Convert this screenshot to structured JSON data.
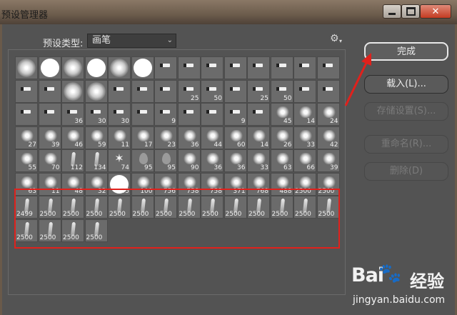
{
  "window": {
    "title": "预设管理器"
  },
  "preset_type": {
    "label": "预设类型:",
    "value": "画笔"
  },
  "buttons": {
    "done": "完成",
    "load": "载入(L)...",
    "save": "存储设置(S)...",
    "rename": "重命名(R)...",
    "delete": "删除(D)"
  },
  "brushes": [
    {
      "kind": "soft",
      "n": ""
    },
    {
      "kind": "hard",
      "n": ""
    },
    {
      "kind": "soft",
      "n": ""
    },
    {
      "kind": "hard",
      "n": ""
    },
    {
      "kind": "soft",
      "n": ""
    },
    {
      "kind": "hard",
      "n": ""
    },
    {
      "kind": "tip",
      "n": ""
    },
    {
      "kind": "tip",
      "n": ""
    },
    {
      "kind": "tip",
      "n": ""
    },
    {
      "kind": "tip",
      "n": ""
    },
    {
      "kind": "tip",
      "n": ""
    },
    {
      "kind": "tip",
      "n": ""
    },
    {
      "kind": "tip",
      "n": ""
    },
    {
      "kind": "tip",
      "n": ""
    },
    {
      "kind": "tip",
      "n": ""
    },
    {
      "kind": "tip",
      "n": ""
    },
    {
      "kind": "soft",
      "n": ""
    },
    {
      "kind": "soft",
      "n": ""
    },
    {
      "kind": "tip",
      "n": ""
    },
    {
      "kind": "tip",
      "n": ""
    },
    {
      "kind": "tip",
      "n": ""
    },
    {
      "kind": "tip",
      "n": "25"
    },
    {
      "kind": "tip",
      "n": "50"
    },
    {
      "kind": "tip",
      "n": ""
    },
    {
      "kind": "tip",
      "n": "25"
    },
    {
      "kind": "tip",
      "n": "50"
    },
    {
      "kind": "tip",
      "n": ""
    },
    {
      "kind": "tip",
      "n": ""
    },
    {
      "kind": "tip",
      "n": ""
    },
    {
      "kind": "tip",
      "n": ""
    },
    {
      "kind": "tip",
      "n": "36"
    },
    {
      "kind": "tip",
      "n": "30"
    },
    {
      "kind": "tip",
      "n": "30"
    },
    {
      "kind": "tip",
      "n": ""
    },
    {
      "kind": "tip",
      "n": "9"
    },
    {
      "kind": "tip",
      "n": ""
    },
    {
      "kind": "tip",
      "n": ""
    },
    {
      "kind": "tip",
      "n": "9"
    },
    {
      "kind": "tip",
      "n": ""
    },
    {
      "kind": "splat",
      "n": "45"
    },
    {
      "kind": "splat",
      "n": "14"
    },
    {
      "kind": "splat",
      "n": "24"
    },
    {
      "kind": "splat",
      "n": "27"
    },
    {
      "kind": "splat",
      "n": "39"
    },
    {
      "kind": "splat",
      "n": "46"
    },
    {
      "kind": "splat",
      "n": "59"
    },
    {
      "kind": "splat",
      "n": "11"
    },
    {
      "kind": "splat",
      "n": "17"
    },
    {
      "kind": "splat",
      "n": "23"
    },
    {
      "kind": "splat",
      "n": "36"
    },
    {
      "kind": "splat",
      "n": "44"
    },
    {
      "kind": "splat",
      "n": "60"
    },
    {
      "kind": "splat",
      "n": "14"
    },
    {
      "kind": "splat",
      "n": "26"
    },
    {
      "kind": "splat",
      "n": "33"
    },
    {
      "kind": "splat",
      "n": "42"
    },
    {
      "kind": "splat",
      "n": "55"
    },
    {
      "kind": "splat",
      "n": "70"
    },
    {
      "kind": "wisp",
      "n": "112"
    },
    {
      "kind": "wisp",
      "n": "134"
    },
    {
      "kind": "star",
      "n": "74"
    },
    {
      "kind": "leaf",
      "n": "95"
    },
    {
      "kind": "leaf",
      "n": "95"
    },
    {
      "kind": "splat",
      "n": "90"
    },
    {
      "kind": "splat",
      "n": "36"
    },
    {
      "kind": "splat",
      "n": "36"
    },
    {
      "kind": "splat",
      "n": "33"
    },
    {
      "kind": "splat",
      "n": "63"
    },
    {
      "kind": "splat",
      "n": "66"
    },
    {
      "kind": "splat",
      "n": "39"
    },
    {
      "kind": "splat",
      "n": "63"
    },
    {
      "kind": "splat",
      "n": "11"
    },
    {
      "kind": "splat",
      "n": "48"
    },
    {
      "kind": "splat",
      "n": "32"
    },
    {
      "kind": "hard",
      "n": "55"
    },
    {
      "kind": "splat",
      "n": "100"
    },
    {
      "kind": "splat",
      "n": "756"
    },
    {
      "kind": "splat",
      "n": "758"
    },
    {
      "kind": "splat",
      "n": "758"
    },
    {
      "kind": "splat",
      "n": "371"
    },
    {
      "kind": "splat",
      "n": "768"
    },
    {
      "kind": "splat",
      "n": "488"
    },
    {
      "kind": "splat",
      "n": "2500"
    },
    {
      "kind": "splat",
      "n": "2500"
    },
    {
      "kind": "wisp",
      "n": "2499"
    },
    {
      "kind": "wisp",
      "n": "2500"
    },
    {
      "kind": "wisp",
      "n": "2500"
    },
    {
      "kind": "wisp",
      "n": "2500"
    },
    {
      "kind": "wisp",
      "n": "2500"
    },
    {
      "kind": "wisp",
      "n": "2500"
    },
    {
      "kind": "wisp",
      "n": "2500"
    },
    {
      "kind": "wisp",
      "n": "2500"
    },
    {
      "kind": "wisp",
      "n": "2500"
    },
    {
      "kind": "wisp",
      "n": "2500"
    },
    {
      "kind": "wisp",
      "n": "2500"
    },
    {
      "kind": "wisp",
      "n": "2500"
    },
    {
      "kind": "wisp",
      "n": "2500"
    },
    {
      "kind": "wisp",
      "n": "2500"
    },
    {
      "kind": "wisp",
      "n": "2500"
    },
    {
      "kind": "wisp",
      "n": "2500"
    },
    {
      "kind": "wisp",
      "n": "2500"
    },
    {
      "kind": "wisp",
      "n": "2500"
    }
  ],
  "watermark": {
    "brand": "Bai",
    "brand_cn": "经验",
    "url": "jingyan.baidu.com"
  },
  "colors": {
    "highlight_box": "#e0211c",
    "panel_bg": "#535353"
  }
}
